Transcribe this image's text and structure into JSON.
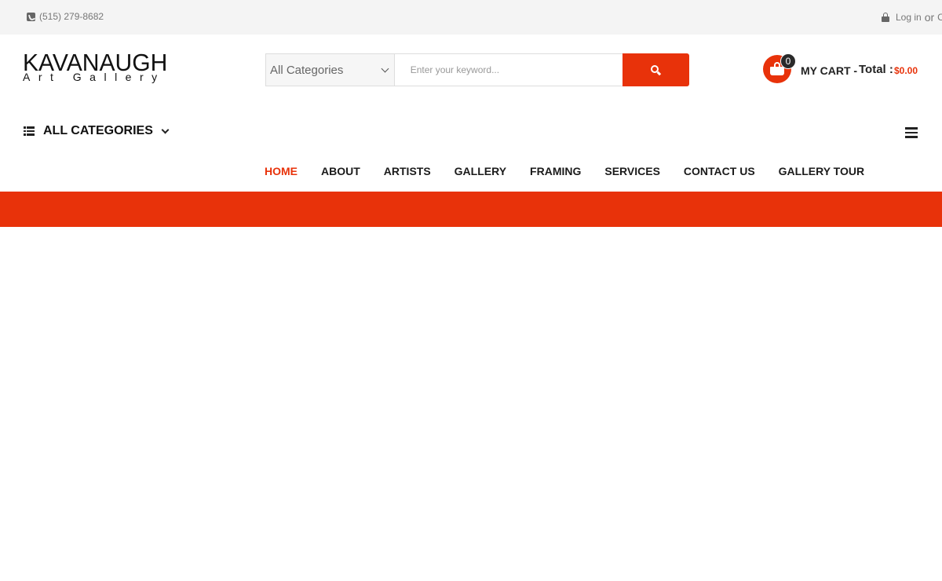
{
  "topbar": {
    "phone": "(515) 279-8682",
    "login": "Log in",
    "or": "or",
    "create": "C"
  },
  "logo": {
    "main": "KAVANAUGH",
    "sub": "Art Gallery"
  },
  "search": {
    "category_selected": "All Categories",
    "placeholder": "Enter your keyword..."
  },
  "cart": {
    "count": "0",
    "label": "MY CART -",
    "total_label": "Total :",
    "total_value": "$0.00"
  },
  "all_categories": {
    "label": "ALL CATEGORIES"
  },
  "nav": {
    "items": [
      {
        "label": "HOME",
        "active": true
      },
      {
        "label": "ABOUT"
      },
      {
        "label": "ARTISTS"
      },
      {
        "label": "GALLERY"
      },
      {
        "label": "FRAMING"
      },
      {
        "label": "SERVICES"
      },
      {
        "label": "CONTACT US"
      },
      {
        "label": "GALLERY TOUR"
      }
    ]
  },
  "colors": {
    "accent": "#e8320a",
    "topbar_bg": "#f4f4f4",
    "text_dark": "#1b1b1b"
  },
  "icons": [
    "phone-icon",
    "lock-icon",
    "search-icon",
    "cart-icon",
    "list-icon",
    "chevron-down-icon",
    "menu-icon"
  ]
}
